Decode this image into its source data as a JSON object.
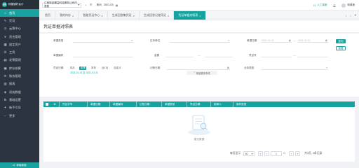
{
  "app": {
    "logo_text": "畅捷通好会计",
    "logo_mark": "好",
    "company": "江西新金蝶益科技服务公司代表账",
    "period_label": "期间",
    "period_value": "2021-03",
    "service": "人工客服",
    "user": "畅捷通"
  },
  "sidebar": {
    "items": [
      {
        "icon": "⌂",
        "label": "首页",
        "active": true
      },
      {
        "icon": "✎",
        "label": "凭证",
        "active": false
      },
      {
        "icon": "◷",
        "label": "云票中心",
        "active": false
      },
      {
        "icon": "¥",
        "label": "资金管理",
        "active": false
      },
      {
        "icon": "▦",
        "label": "固定资产",
        "active": false
      },
      {
        "icon": "☰",
        "label": "工资",
        "active": false
      },
      {
        "icon": "▤",
        "label": "发票管理",
        "active": false
      },
      {
        "icon": "▣",
        "label": "库存核算",
        "active": false
      },
      {
        "icon": "✉",
        "label": "账务管理",
        "active": false
      },
      {
        "icon": "▥",
        "label": "报表",
        "active": false
      },
      {
        "icon": "◈",
        "label": "初始数据",
        "active": false
      },
      {
        "icon": "⚙",
        "label": "基础设置",
        "active": false
      },
      {
        "icon": "✦",
        "label": "新手引导",
        "active": false
      },
      {
        "icon": "⋯",
        "label": "更多",
        "active": false
      }
    ],
    "footer": "体验新版"
  },
  "tabs": [
    {
      "label": "首页",
      "closable": false,
      "active": false
    },
    {
      "label": "我的待办",
      "closable": true,
      "active": false
    },
    {
      "label": "智能凭证中心",
      "closable": true,
      "active": false
    },
    {
      "label": "生成回答集凭证",
      "closable": true,
      "active": false
    },
    {
      "label": "生成回答记账凭证",
      "closable": true,
      "active": false
    },
    {
      "label": "凭证单据对照表",
      "closable": true,
      "active": true
    }
  ],
  "page": {
    "title": "凭证单据对照表"
  },
  "filters": {
    "doc_type_label": "单据类型",
    "contact_label": "往来单位",
    "doc_date_label": "单据日期",
    "doc_date_start": "2021-01-01",
    "doc_date_end": "2021-03-31",
    "doc_no_label": "单据编码",
    "amount_label": "金额",
    "amount_sep": "—",
    "voucher_no_label": "凭证号",
    "voucher_no_sep": "—",
    "voucher_date_label": "凭证日期",
    "voucher_date_chips": [
      "本月",
      "本季",
      "本年",
      "近1月",
      "自定义"
    ],
    "voucher_date_range": "2021-01-01 至 2021-03-31",
    "record_date_label": "记账日期",
    "business_type_label": "业务类型",
    "search_button": "查询",
    "reset_button": "重置",
    "expand_link": "收起更多条件"
  },
  "table": {
    "columns": [
      "凭证字号",
      "单据日期",
      "单据编码",
      "记账日期",
      "单据类型",
      "凭证日期",
      "制单人",
      "操作类型"
    ],
    "rows": [],
    "empty_text": "暂无数据"
  },
  "pagination": {
    "per_page_label": "每页显示",
    "per_page_value": "50",
    "current_page": "1",
    "total_pages": "/1",
    "total_text": "共0页, 0条记录"
  },
  "colors": {
    "accent": "#16a3a0",
    "sidebar_bg": "#2b3440"
  }
}
